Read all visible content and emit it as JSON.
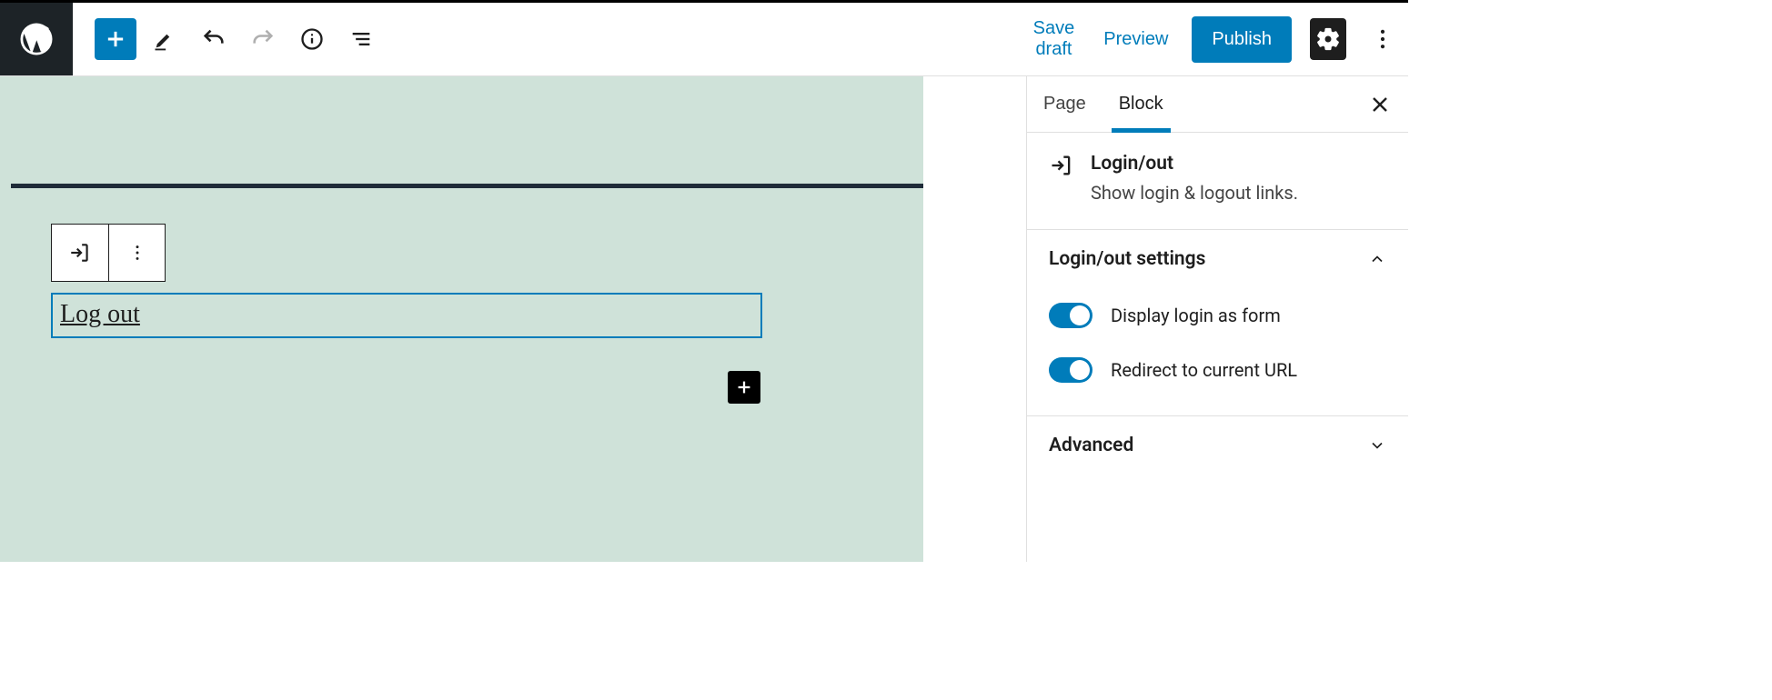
{
  "topbar": {
    "save_draft": "Save draft",
    "preview": "Preview",
    "publish": "Publish"
  },
  "canvas": {
    "block_link_text": "Log out"
  },
  "sidebar": {
    "tabs": {
      "page": "Page",
      "block": "Block",
      "active": "block"
    },
    "block_card": {
      "title": "Login/out",
      "description": "Show login & logout links."
    },
    "settings_panel": {
      "title": "Login/out settings",
      "open": true,
      "opt_display_form": {
        "label": "Display login as form",
        "on": true
      },
      "opt_redirect": {
        "label": "Redirect to current URL",
        "on": true
      }
    },
    "advanced_panel": {
      "title": "Advanced",
      "open": false
    }
  },
  "colors": {
    "accent": "#007cba"
  }
}
